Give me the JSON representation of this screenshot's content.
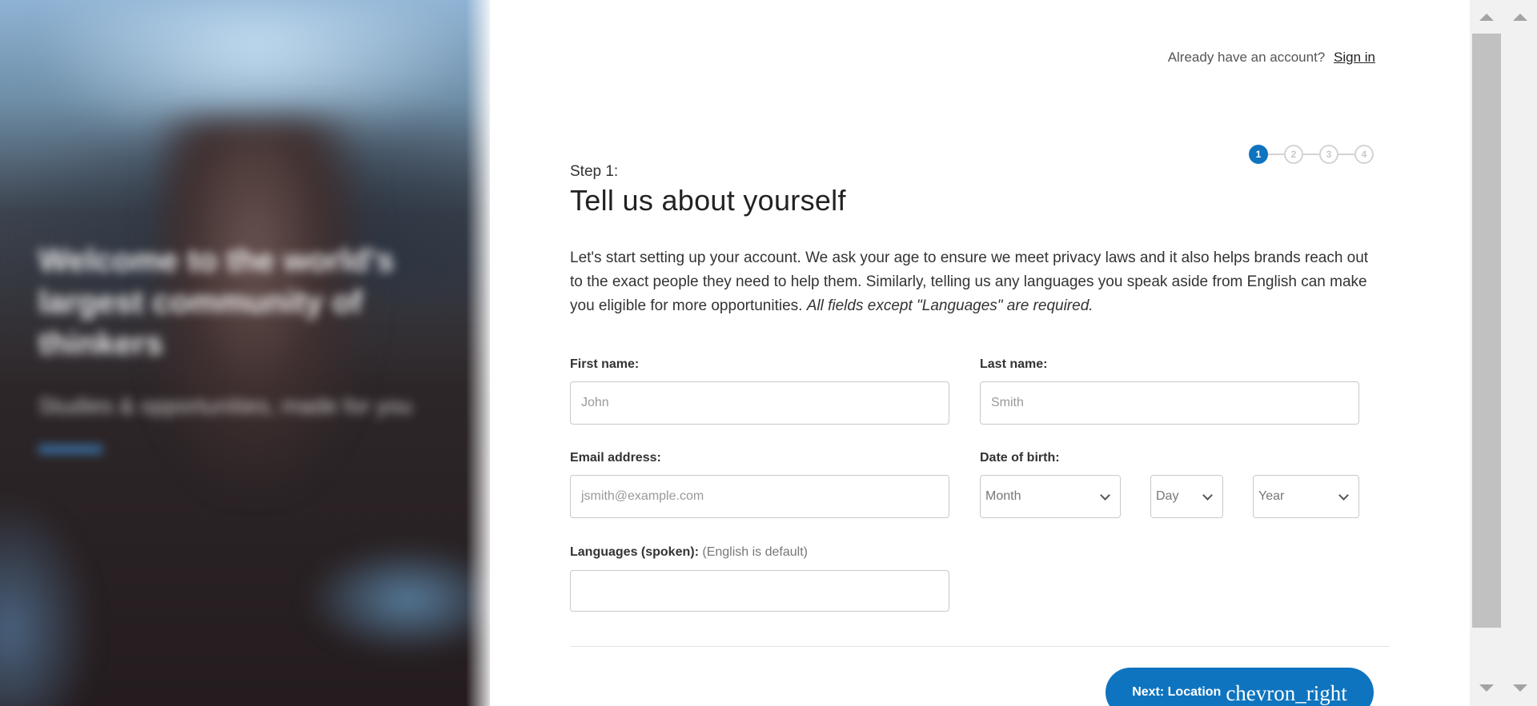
{
  "hero": {
    "title": "Welcome to the world's largest community of thinkers",
    "subtitle": "Studies & opportunities, made for you",
    "link": "Learn more"
  },
  "header": {
    "prompt": "Already have an account?",
    "signin_label": "Sign in"
  },
  "stepper": {
    "steps": [
      "1",
      "2",
      "3",
      "4"
    ],
    "active": 1
  },
  "form": {
    "step_label": "Step 1:",
    "title": "Tell us about yourself",
    "intro": "Let's start setting up your account. We ask your age to ensure we meet privacy laws and it also helps brands reach out to the exact people they need to help them. Similarly, telling us any languages you speak aside from English can make you eligible for more opportunities.",
    "intro_note": "All fields except \"Languages\" are required.",
    "first_name": {
      "label": "First name:",
      "placeholder": "John"
    },
    "last_name": {
      "label": "Last name:",
      "placeholder": "Smith"
    },
    "email": {
      "label": "Email address:",
      "placeholder": "jsmith@example.com"
    },
    "dob": {
      "label": "Date of birth:",
      "month": "Month",
      "day": "Day",
      "year": "Year"
    },
    "languages": {
      "label": "Languages (spoken):",
      "hint": "(English is default)",
      "value": ""
    }
  },
  "footer": {
    "next_label": "Next: Location",
    "next_icon": "chevron_right"
  },
  "colors": {
    "primary": "#0f74bf",
    "border": "#c9c9c9",
    "scrollbar_thumb": "#c1c1c1"
  }
}
